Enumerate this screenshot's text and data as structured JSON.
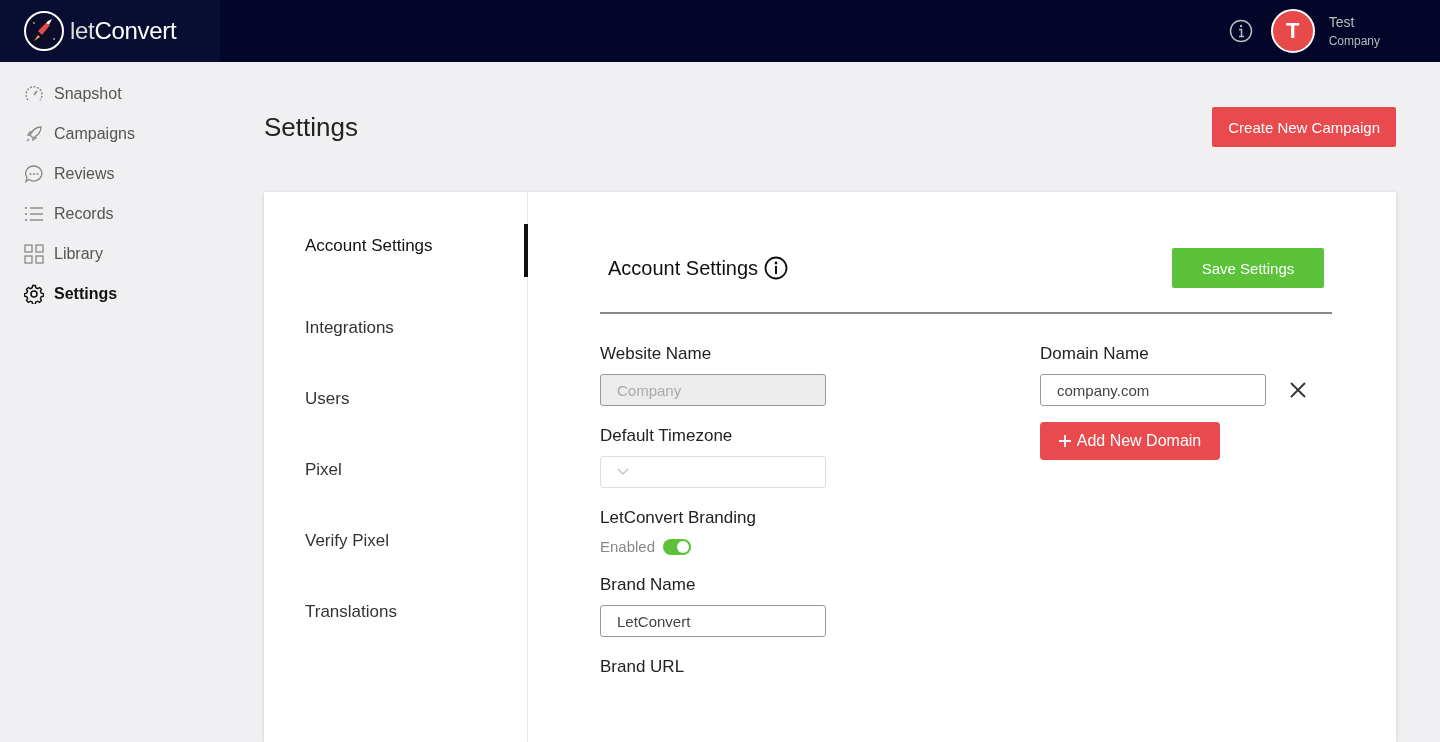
{
  "brand": {
    "prefix": "let",
    "name": "Convert"
  },
  "user": {
    "initial": "T",
    "name": "Test",
    "company": "Company"
  },
  "sidebar": {
    "items": [
      {
        "label": "Snapshot",
        "selected": false
      },
      {
        "label": "Campaigns",
        "selected": false
      },
      {
        "label": "Reviews",
        "selected": false
      },
      {
        "label": "Records",
        "selected": false
      },
      {
        "label": "Library",
        "selected": false
      },
      {
        "label": "Settings",
        "selected": true
      }
    ]
  },
  "page": {
    "title": "Settings",
    "action": "Create New Campaign"
  },
  "settings_tabs": [
    {
      "label": "Account Settings",
      "selected": true
    },
    {
      "label": "Integrations",
      "selected": false
    },
    {
      "label": "Users",
      "selected": false
    },
    {
      "label": "Pixel",
      "selected": false
    },
    {
      "label": "Verify Pixel",
      "selected": false
    },
    {
      "label": "Translations",
      "selected": false
    }
  ],
  "panel": {
    "title": "Account Settings",
    "save": "Save Settings"
  },
  "fields": [
    {
      "kind": "input",
      "label": "Website Name",
      "value": "Company",
      "disabled": true
    },
    {
      "kind": "select",
      "label": "Default Timezone"
    },
    {
      "kind": "toggle",
      "label": "LetConvert Branding",
      "state_label": "Enabled",
      "on": true
    },
    {
      "kind": "input",
      "label": "Brand Name",
      "value": "LetConvert",
      "disabled": false
    },
    {
      "kind": "label",
      "label": "Brand URL"
    }
  ],
  "domain": {
    "label": "Domain Name",
    "value": "company.com",
    "add": "Add New Domain"
  }
}
